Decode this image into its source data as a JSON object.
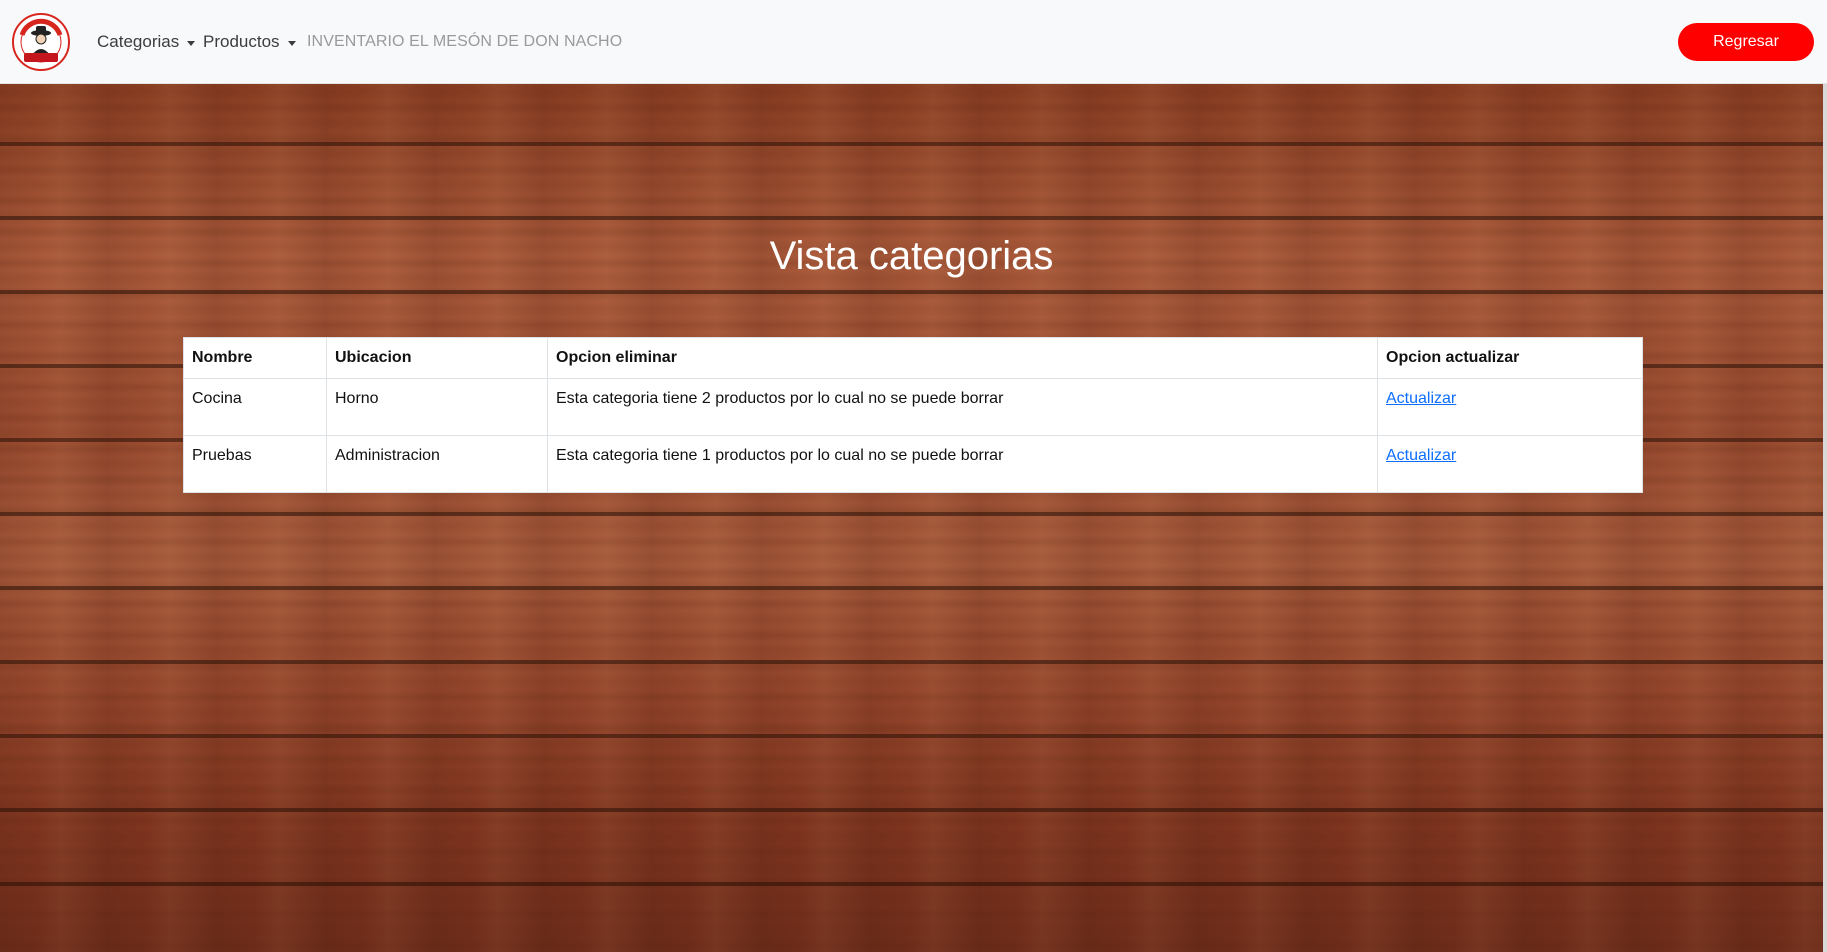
{
  "navbar": {
    "logo": {
      "icon": "don-nacho-logo",
      "top_text": "RESTAURANTE EL MESON",
      "bottom_text": "DON NACHO",
      "colors": {
        "ring": "#d7261e",
        "ribbon": "#c4161c",
        "face": "#222222"
      }
    },
    "menu": [
      {
        "label": "Categorias",
        "icon": "caret-down-icon"
      },
      {
        "label": "Productos",
        "icon": "caret-down-icon"
      }
    ],
    "brand_text": "INVENTARIO EL MESÓN DE DON NACHO",
    "back_button": {
      "label": "Regresar",
      "color": "#ff0000"
    }
  },
  "main": {
    "title": "Vista categorias",
    "background": "wood-planks",
    "table": {
      "headers": [
        "Nombre",
        "Ubicacion",
        "Opcion eliminar",
        "Opcion actualizar"
      ],
      "rows": [
        {
          "nombre": "Cocina",
          "ubicacion": "Horno",
          "eliminar": "Esta categoria tiene 2 productos por lo cual no se puede borrar",
          "actualizar": "Actualizar"
        },
        {
          "nombre": "Pruebas",
          "ubicacion": "Administracion",
          "eliminar": "Esta categoria tiene 1 productos por lo cual no se puede borrar",
          "actualizar": "Actualizar"
        }
      ]
    }
  },
  "colors": {
    "link": "#0d6efd",
    "navbar_bg": "#f8f9fa",
    "title": "#ffffff"
  }
}
